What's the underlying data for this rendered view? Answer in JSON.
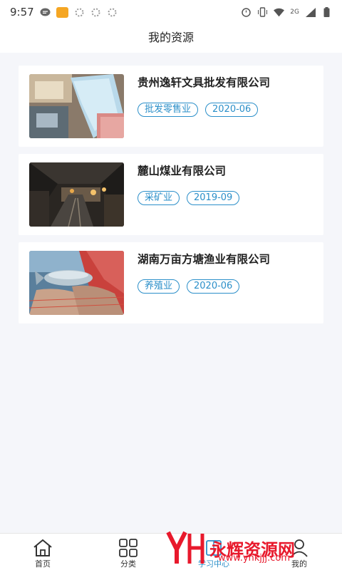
{
  "status": {
    "time": "9:57",
    "network": "2G"
  },
  "header": {
    "title": "我的资源"
  },
  "resources": [
    {
      "company": "贵州逸轩文具批发有限公司",
      "industry": "批发零售业",
      "date": "2020-06"
    },
    {
      "company": "麓山煤业有限公司",
      "industry": "采矿业",
      "date": "2019-09"
    },
    {
      "company": "湖南万亩方塘渔业有限公司",
      "industry": "养殖业",
      "date": "2020-06"
    }
  ],
  "tabs": [
    {
      "label": "首页",
      "icon": "home-icon"
    },
    {
      "label": "分类",
      "icon": "grid-icon"
    },
    {
      "label": "学习中心",
      "icon": "book-icon"
    },
    {
      "label": "我的",
      "icon": "user-icon"
    }
  ],
  "watermark": {
    "brand": "永辉资源网",
    "url": "www.yhkjjj.com"
  },
  "colors": {
    "accent": "#2b8fc9",
    "watermark": "#e8192c"
  }
}
